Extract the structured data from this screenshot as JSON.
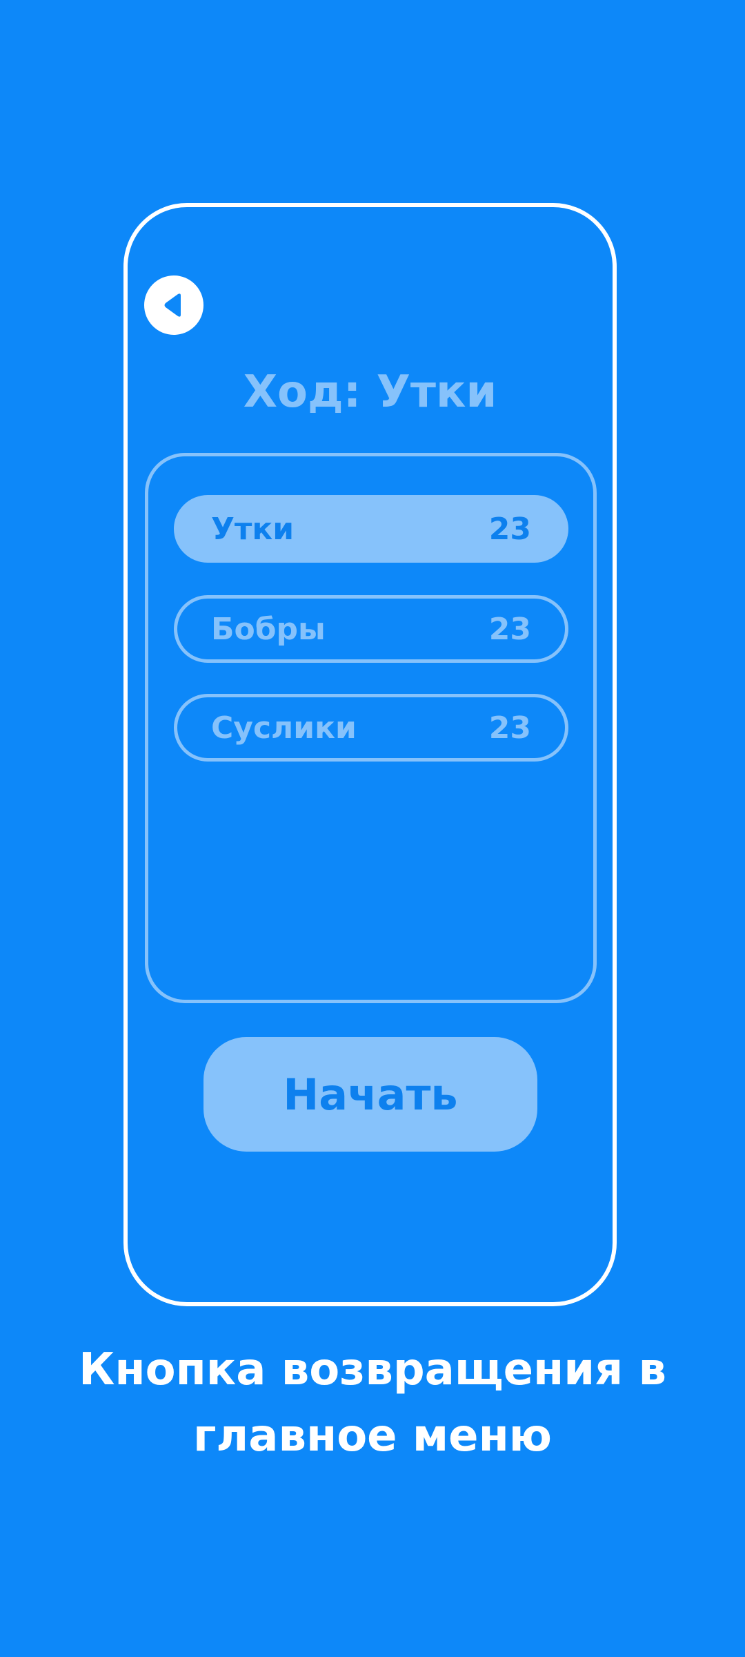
{
  "colors": {
    "background": "#0D88F9",
    "frame": "#FFFFFF",
    "muted": "#86C2FB",
    "accent_text": "#0D80EE"
  },
  "back_button": {
    "icon": "play-back-triangle-icon"
  },
  "turn": {
    "title": "Ход: Утки"
  },
  "teams": [
    {
      "name": "Утки",
      "score": "23",
      "active": true
    },
    {
      "name": "Бобры",
      "score": "23",
      "active": false
    },
    {
      "name": "Суслики",
      "score": "23",
      "active": false
    }
  ],
  "start_button": {
    "label": "Начать"
  },
  "caption": {
    "line1": "Кнопка возвращения в",
    "line2": "главное меню"
  }
}
